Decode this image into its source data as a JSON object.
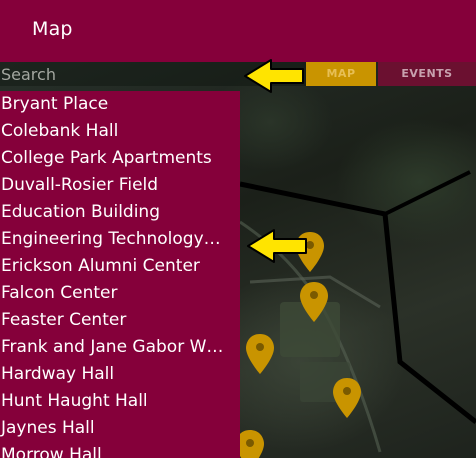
{
  "app_bar": {
    "title": "Map"
  },
  "search": {
    "placeholder": "Search",
    "value": ""
  },
  "tabs": [
    {
      "label": "MAP",
      "selected": true
    },
    {
      "label": "EVENTS",
      "selected": false
    }
  ],
  "locations": [
    "Bryant Place",
    "Colebank Hall",
    "College Park Apartments",
    "Duvall-Rosier Field",
    "Education Building",
    "Engineering Technology…",
    "Erickson Alumni Center",
    "Falcon Center",
    "Feaster Center",
    "Frank and Jane Gabor W…",
    "Hardway Hall",
    "Hunt Haught Hall",
    "Jaynes Hall",
    "Morrow Hall"
  ],
  "colors": {
    "brand": "#85003a",
    "map_tab": "#c99400",
    "annotation_arrow": "#ffe400",
    "map_pin": "#c99400"
  },
  "icons": [
    "arrow-left-icon",
    "map-pin-icon"
  ]
}
